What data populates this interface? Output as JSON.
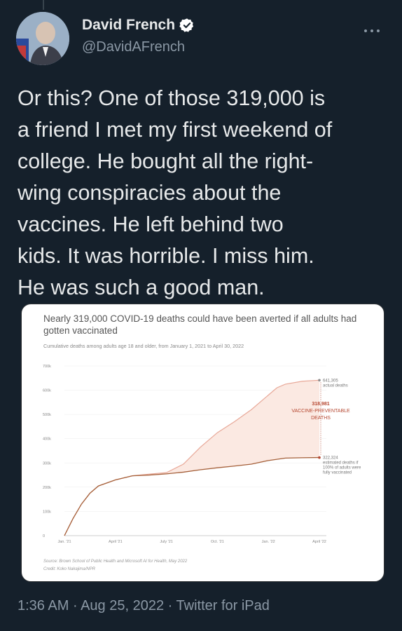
{
  "author": {
    "name": "David French",
    "handle": "@DavidAFrench",
    "verified": true
  },
  "menu_icon": "more-horizontal-icon",
  "tweet": {
    "lines": [
      "Or this? One of those 319,000 is",
      "a friend I met my first weekend of",
      "college. He bought all the right-",
      "wing conspiracies about the",
      "vaccines. He left behind two",
      "kids. It was horrible. I miss him.",
      "He was such a good man."
    ]
  },
  "footer": {
    "time": "1:36 AM",
    "date": "Aug 25, 2022",
    "client": "Twitter for iPad",
    "separator": "·"
  },
  "colors": {
    "background": "#15202b",
    "text": "#e7e9ea",
    "muted": "#8b98a5",
    "verified": "#ffffff",
    "actual_line": "#e8a898",
    "vaccinated_line": "#a5603a",
    "gap_fill": "#fbe9e2",
    "annotation": "#b5462f"
  },
  "chart_data": {
    "type": "line",
    "title": "Nearly 319,000 COVID-19 deaths could have been averted if all adults had gotten vaccinated",
    "subtitle": "Cumulative deaths among adults age 18 and older, from January 1, 2021 to April 30, 2022",
    "x_tick_labels": [
      "Jan. '21",
      "April '21",
      "July '21",
      "Oct. '21",
      "Jan. '22",
      "April '22"
    ],
    "y_tick_labels": [
      "0",
      "100k",
      "200k",
      "300k",
      "400k",
      "500k",
      "600k",
      "700k"
    ],
    "ylim": [
      0,
      700000
    ],
    "x_months": [
      0,
      15
    ],
    "series": [
      {
        "name": "actual deaths",
        "x": [
          0,
          0.5,
          1,
          1.5,
          2,
          3,
          4,
          5,
          6,
          7,
          7.5,
          8,
          8.5,
          9,
          10,
          11,
          12,
          12.5,
          13,
          14,
          15
        ],
        "y": [
          0,
          70000,
          130000,
          175000,
          205000,
          230000,
          247000,
          254000,
          260000,
          295000,
          330000,
          365000,
          395000,
          425000,
          470000,
          520000,
          580000,
          610000,
          625000,
          637000,
          641305
        ]
      },
      {
        "name": "estimated deaths if 100% of adults were fully vaccinated",
        "x": [
          0,
          0.5,
          1,
          1.5,
          2,
          3,
          4,
          5,
          6,
          7,
          8,
          9,
          10,
          11,
          12,
          13,
          14,
          15
        ],
        "y": [
          0,
          70000,
          130000,
          175000,
          205000,
          230000,
          247000,
          250000,
          255000,
          262000,
          272000,
          280000,
          287000,
          295000,
          310000,
          320000,
          321500,
          322324
        ]
      }
    ],
    "annotations": {
      "actual_value": "641,305",
      "actual_label": "actual deaths",
      "gap_value": "318,981",
      "gap_label_1": "VACCINE-PREVENTABLE",
      "gap_label_2": "DEATHS",
      "est_value": "322,324",
      "est_label_1": "estimated deaths if",
      "est_label_2": "100% of adults were",
      "est_label_3": "fully vaccinated"
    },
    "source": "Source: Brown School of Public Health and Microsoft AI for Health, May 2022",
    "credit": "Credit: Koko Nakajima/NPR"
  }
}
